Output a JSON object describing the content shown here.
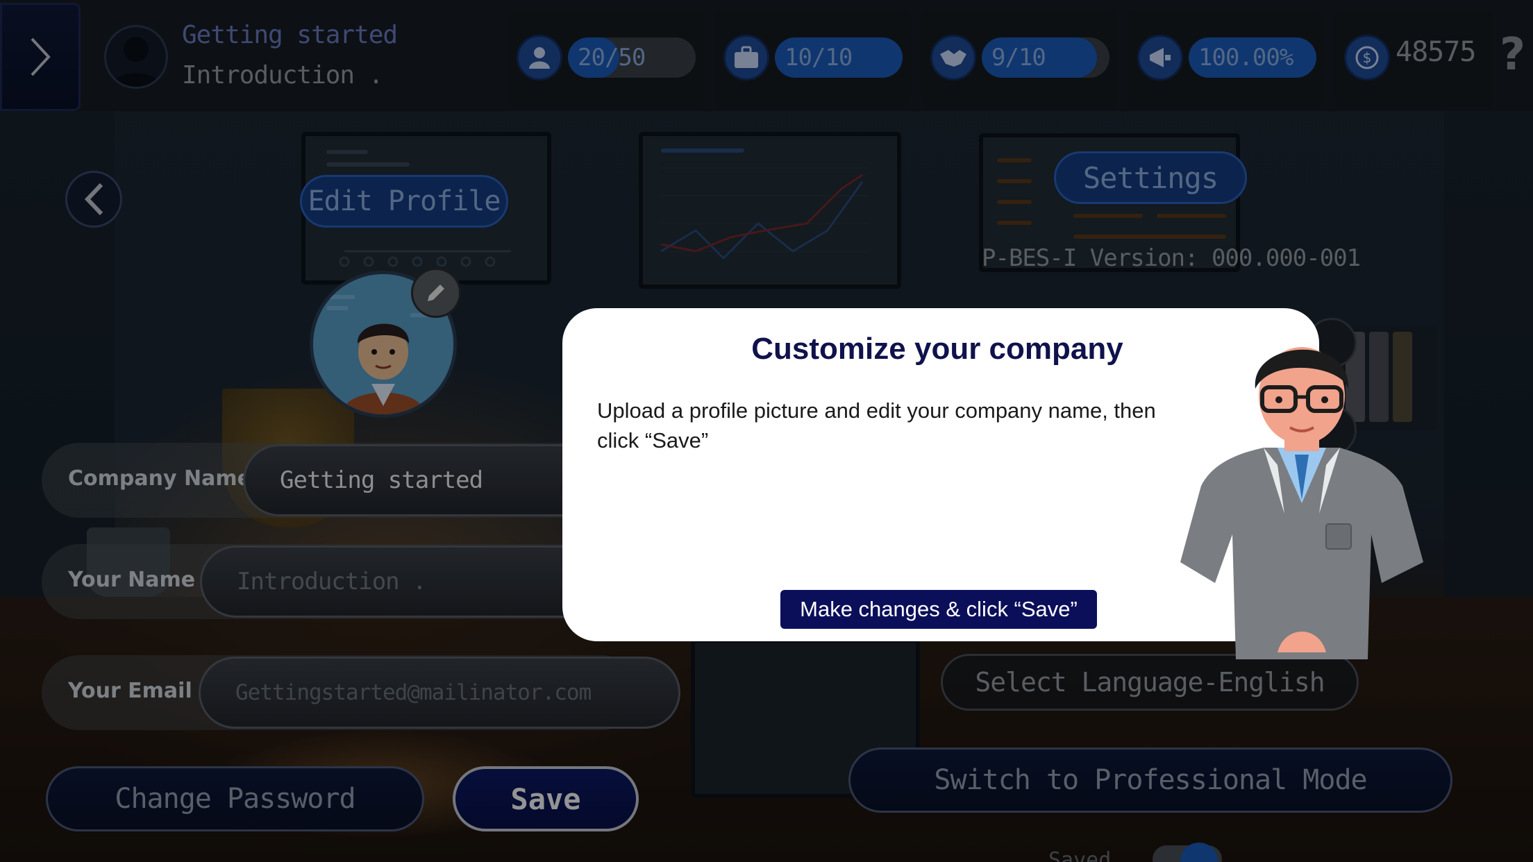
{
  "header": {
    "company_name": "Getting started",
    "user_name": "Introduction .",
    "stats": [
      {
        "icon": "employee-icon",
        "label": "20/50",
        "fill": 0.4
      },
      {
        "icon": "briefcase-icon",
        "label": "10/10",
        "fill": 1.0
      },
      {
        "icon": "handshake-icon",
        "label": "9/10",
        "fill": 0.9
      },
      {
        "icon": "megaphone-icon",
        "label": "100.00%",
        "fill": 1.0
      }
    ],
    "coins": "48575",
    "help": "?"
  },
  "profile": {
    "edit_profile_label": "Edit Profile",
    "company_name_label": "Company Name",
    "company_name_value": "Getting started",
    "your_name_label": "Your Name",
    "your_name_value": "Introduction .",
    "your_email_label": "Your Email",
    "your_email_value": "Gettingstarted@mailinator.com",
    "change_password_label": "Change Password",
    "save_label": "Save"
  },
  "settings": {
    "settings_label": "Settings",
    "version": "P-BES-I Version: 000.000-001",
    "language_label": "Select Language-English",
    "switch_mode_label": "Switch to Professional Mode",
    "saved_label": "Saved"
  },
  "tutorial": {
    "title": "Customize your company",
    "body": "Upload a profile picture and edit your company name, then click “Save”",
    "cta": "Make changes & click “Save”"
  },
  "colors": {
    "accent_blue": "#1a5dbf",
    "navy_button": "#0b0f5a",
    "modal_title": "#10124c"
  }
}
